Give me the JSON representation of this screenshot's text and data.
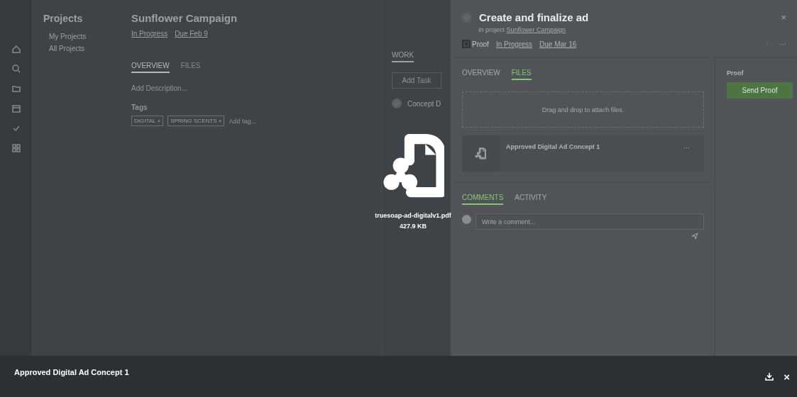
{
  "sidebar": {
    "title": "Projects",
    "items": [
      {
        "label": "My Projects",
        "selected": false
      },
      {
        "label": "All Projects",
        "selected": false
      }
    ]
  },
  "project": {
    "title": "Sunflower Campaign",
    "status": "In Progress",
    "due": "Due Feb 9",
    "tabs": [
      {
        "label": "OVERVIEW",
        "selected": true
      },
      {
        "label": "FILES",
        "selected": false
      }
    ],
    "description_placeholder": "Add Description...",
    "tags_label": "Tags",
    "tags": [
      "DIGITAL",
      "SPRING SCENTS"
    ],
    "tag_remove": "×",
    "add_tag_placeholder": "Add tag...",
    "work": {
      "tab": "WORK",
      "add_button": "Add Task",
      "tasks": [
        {
          "label": "Concept D",
          "done": true
        }
      ]
    }
  },
  "task": {
    "title": "Create and finalize ad",
    "done": true,
    "project_prefix": "In project",
    "project_link": "Sunflower Campaign",
    "type": "Proof",
    "status": "In Progress",
    "due": "Due Mar 16",
    "more": "···",
    "close": "×",
    "tabs": [
      {
        "label": "OVERVIEW",
        "selected": false
      },
      {
        "label": "FILES",
        "selected": true
      }
    ],
    "dropzone": "Drag and drop to attach files.",
    "files": [
      {
        "name": "Approved Digital Ad Concept 1",
        "more": "···"
      }
    ],
    "comment_tabs": [
      {
        "label": "COMMENTS",
        "selected": true
      },
      {
        "label": "ACTIVITY",
        "selected": false
      }
    ],
    "comment_placeholder": "Write a comment...",
    "side": {
      "title": "Proof",
      "button": "Send Proof"
    }
  },
  "preview": {
    "filename": "truesoap-ad-digitalv1.pdf",
    "size": "427.9 KB"
  },
  "viewer_bar": {
    "title": "Approved Digital Ad Concept 1",
    "close": "×"
  }
}
